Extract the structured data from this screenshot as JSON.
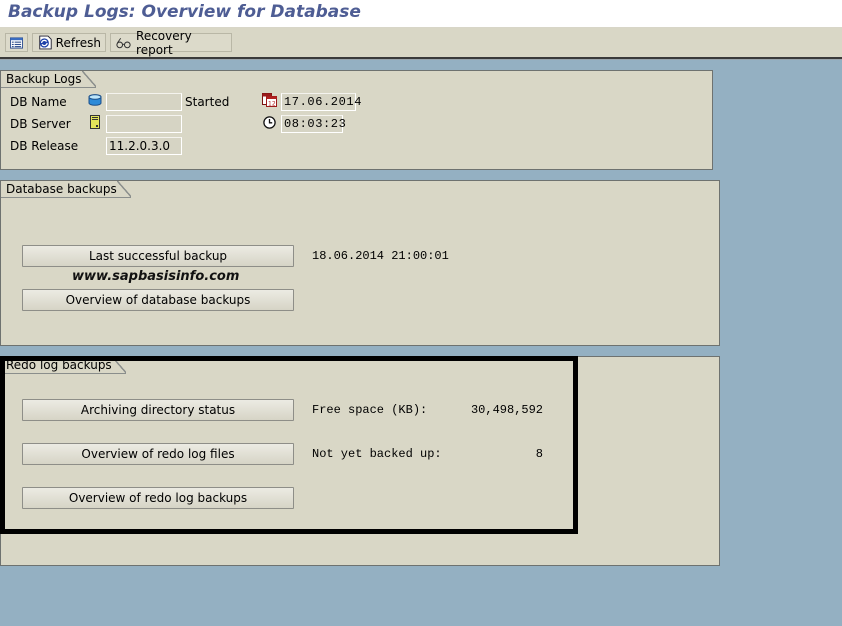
{
  "window": {
    "title": "Backup Logs: Overview for Database"
  },
  "toolbar": {
    "details_icon": "list-view-icon",
    "refresh_label": "Refresh",
    "refresh_icon": "refresh-icon",
    "recovery_label": "Recovery report",
    "recovery_icon": "glasses-icon"
  },
  "backup_logs": {
    "title": "Backup Logs",
    "db_name_label": "DB Name",
    "db_name_value": "",
    "db_server_label": "DB Server",
    "db_server_value": "",
    "db_release_label": "DB Release",
    "db_release_value": "11.2.0.3.0",
    "started_label": "Started",
    "started_date": "17.06.2014",
    "started_time": "08:03:23"
  },
  "database_backups": {
    "title": "Database backups",
    "last_successful_label": "Last successful backup",
    "last_successful_value": "18.06.2014 21:00:01",
    "overview_label": "Overview of database backups"
  },
  "watermark": "www.sapbasisinfo.com",
  "redo_log_backups": {
    "title": "Redo log backups",
    "archiving_label": "Archiving directory status",
    "free_space_label": "Free space (KB):",
    "free_space_value": "30,498,592",
    "redo_files_label": "Overview of redo log files",
    "not_backed_label": "Not yet backed up:",
    "not_backed_value": "8",
    "redo_backups_label": "Overview of redo log backups"
  },
  "colors": {
    "title": "#4e5d94",
    "background": "#94b0c2",
    "panel": "#d9d7c6"
  }
}
